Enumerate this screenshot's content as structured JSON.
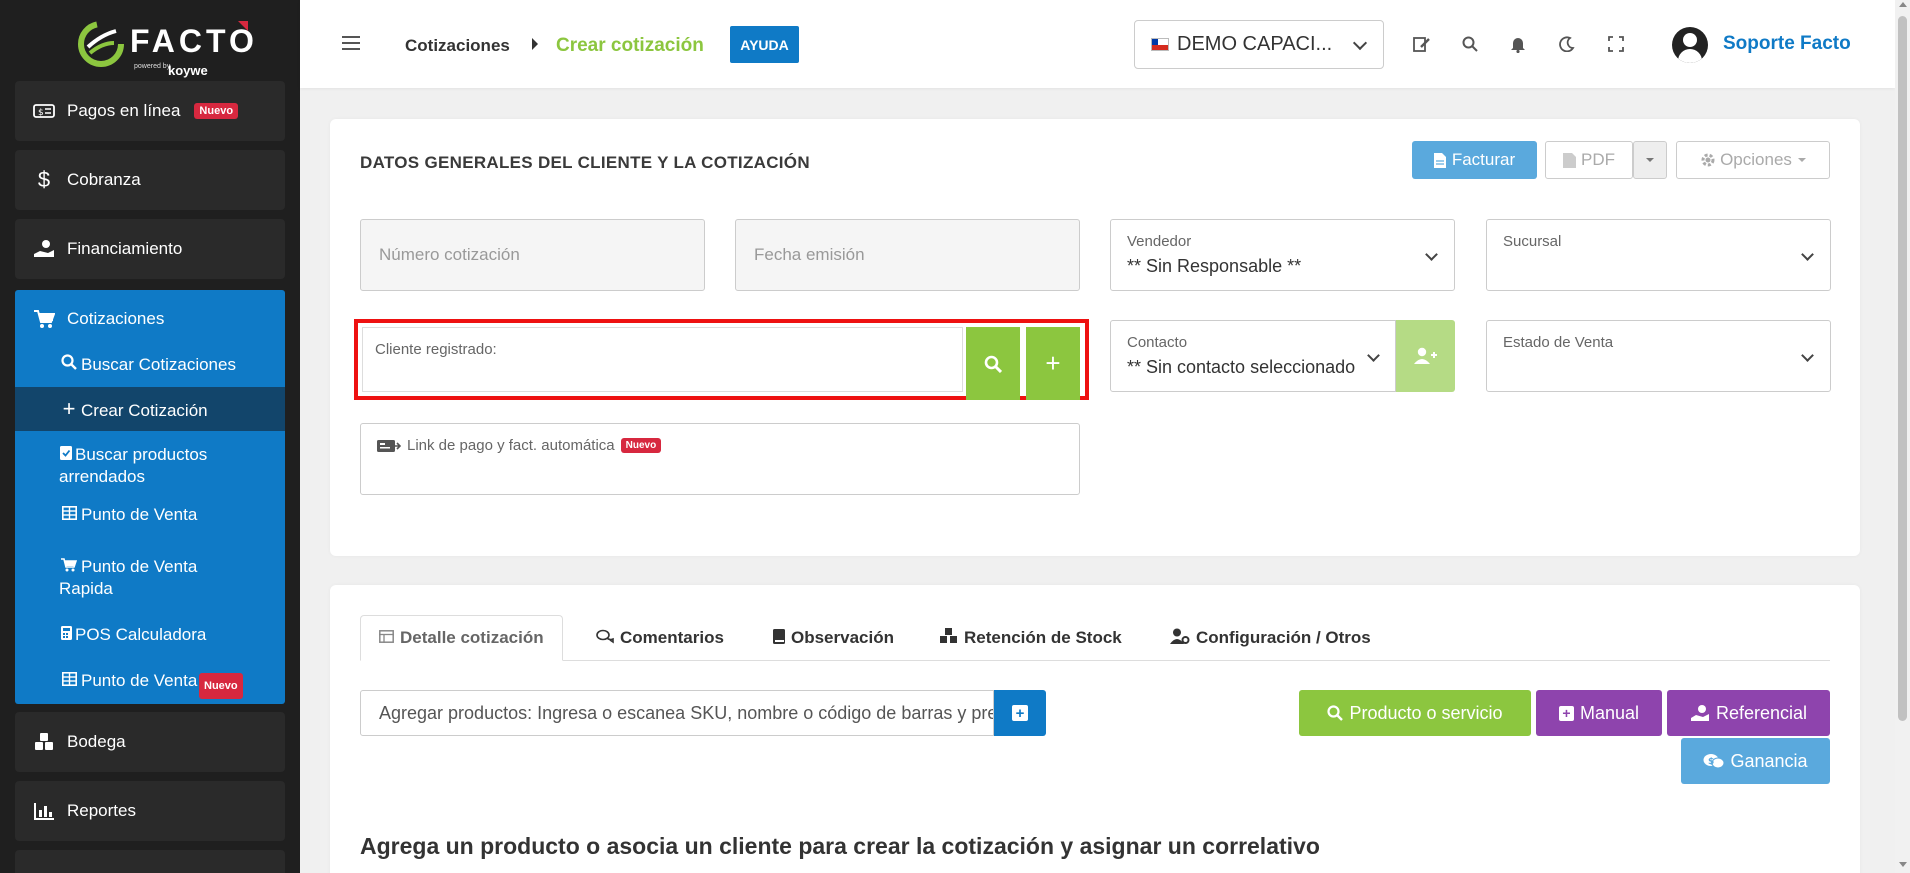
{
  "brand": {
    "name": "FACTO",
    "powered": "powered by",
    "sub": "koywe"
  },
  "sidebar": {
    "items": [
      {
        "label": "Pagos en línea",
        "icon": "money-bill-icon",
        "badge": "Nuevo"
      },
      {
        "label": "Cobranza",
        "icon": "dollar-icon"
      },
      {
        "label": "Financiamiento",
        "icon": "hand-coin-icon"
      },
      {
        "label": "Bodega",
        "icon": "boxes-icon"
      },
      {
        "label": "Reportes",
        "icon": "bar-chart-icon"
      }
    ],
    "group": {
      "label": "Cotizaciones",
      "icon": "cart-icon",
      "children": [
        {
          "label": "Buscar Cotizaciones",
          "icon": "search-icon"
        },
        {
          "label": "Crear Cotización",
          "icon": "plus-icon"
        },
        {
          "label": "Buscar productos arrendados",
          "icon": "clipboard-check-icon"
        },
        {
          "label": "Punto de Venta",
          "icon": "grid-icon"
        },
        {
          "label": "Punto de Venta Rapida",
          "icon": "cart-icon"
        },
        {
          "label": "POS Calculadora",
          "icon": "calculator-icon"
        },
        {
          "label": "Punto de Venta",
          "icon": "grid-icon",
          "badge": "Nuevo"
        }
      ]
    }
  },
  "header": {
    "breadcrumb_1": "Cotizaciones",
    "breadcrumb_2": "Crear cotización",
    "help_label": "AYUDA",
    "company": "DEMO CAPACI...",
    "user_name": "Soporte Facto"
  },
  "general": {
    "title": "DATOS GENERALES DEL CLIENTE Y LA COTIZACIÓN",
    "facturar_label": "Facturar",
    "pdf_label": "PDF",
    "opciones_label": "Opciones",
    "numero_placeholder": "Número cotización",
    "fecha_placeholder": "Fecha emisión",
    "vendedor_label": "Vendedor",
    "vendedor_value": "** Sin Responsable **",
    "sucursal_label": "Sucursal",
    "cliente_label": "Cliente registrado:",
    "contacto_label": "Contacto",
    "contacto_value": "** Sin contacto seleccionado **",
    "estado_label": "Estado de Venta",
    "link_pago_label": "Link de pago y fact. automática",
    "link_pago_badge": "Nuevo"
  },
  "detail": {
    "tabs": [
      {
        "label": "Detalle cotización",
        "icon": "table-icon"
      },
      {
        "label": "Comentarios",
        "icon": "comments-icon"
      },
      {
        "label": "Observación",
        "icon": "book-icon"
      },
      {
        "label": "Retención de Stock",
        "icon": "cubes-icon"
      },
      {
        "label": "Configuración / Otros",
        "icon": "user-gear-icon"
      }
    ],
    "add_products_text": "Agregar productos: Ingresa o escanea SKU, nombre o código de barras y presiona enter",
    "btn_producto": "Producto o servicio",
    "btn_manual": "Manual",
    "btn_referencial": "Referencial",
    "btn_ganancia": "Ganancia",
    "empty_message": "Agrega un producto o asocia un cliente para crear la cotización y asignar un correlativo"
  },
  "colors": {
    "primary_blue": "#0f7ac6",
    "green": "#8cc63f",
    "purple": "#8e44ad",
    "light_blue": "#5aa9dd",
    "badge_red": "#d7283f",
    "sidebar_bg": "#1f1f1f"
  }
}
